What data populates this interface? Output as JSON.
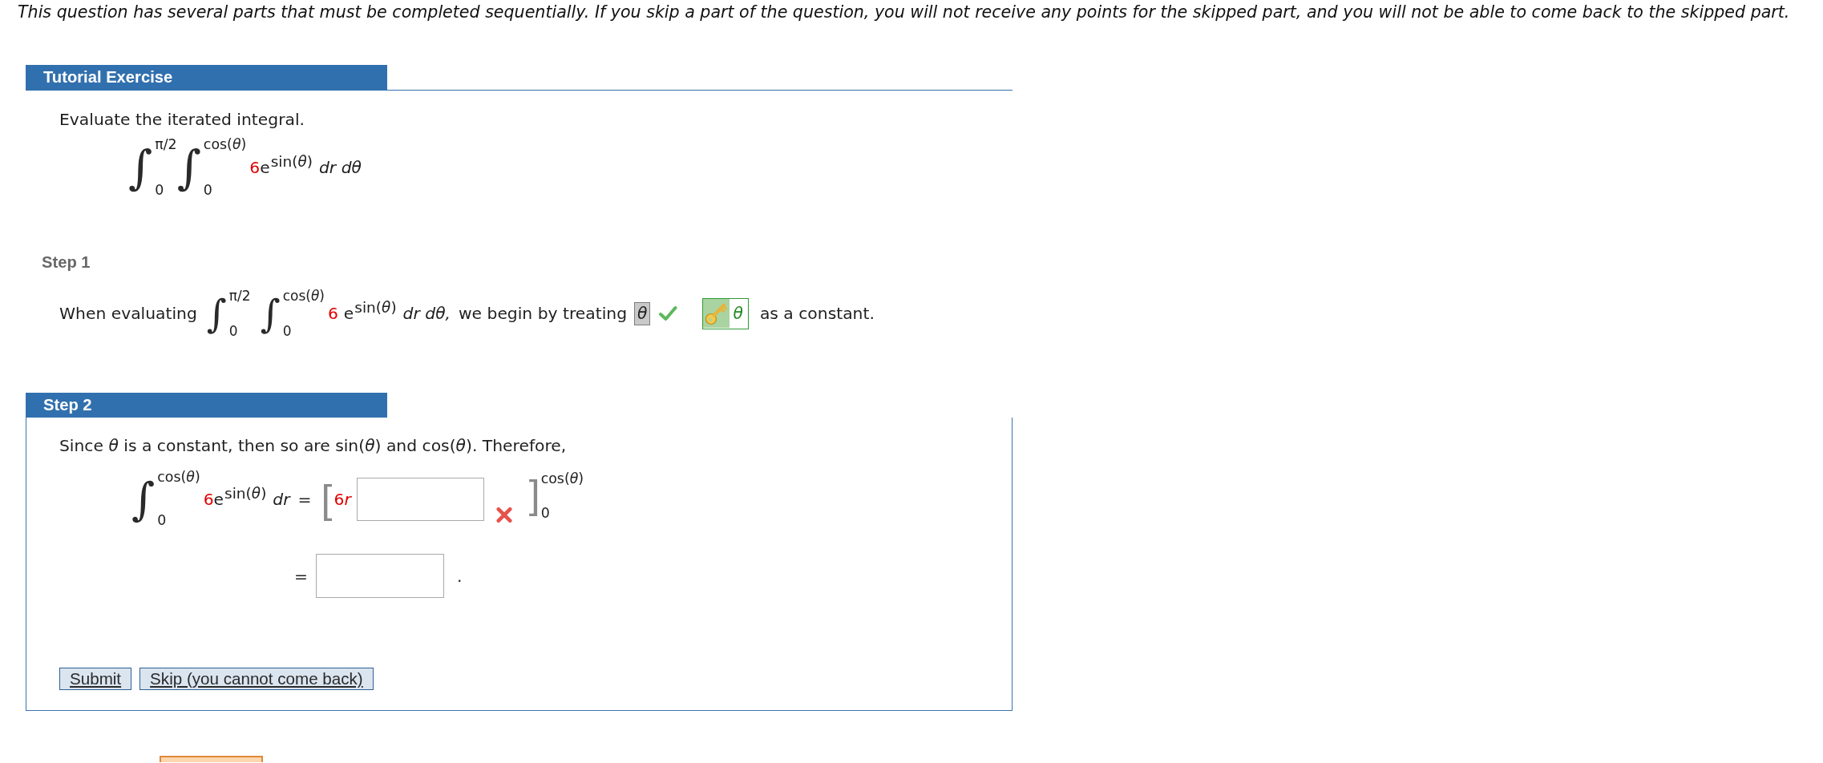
{
  "notice": "This question has several parts that must be completed sequentially. If you skip a part of the question, you will not receive any points for the skipped part, and you will not be able to come back to the skipped part.",
  "tutorial": {
    "title": "Tutorial Exercise",
    "prompt": "Evaluate the iterated integral.",
    "expression": {
      "integrals": [
        {
          "sign": "∫",
          "upper": "π/2",
          "lower": "0"
        },
        {
          "sign": "∫",
          "upper": "cos(*θ*)",
          "lower": "0"
        }
      ],
      "coefficient": "6",
      "base": "e",
      "exponent": "sin(*θ*)",
      "differentials": "dr dθ"
    }
  },
  "step_1": {
    "label": "Step 1",
    "lead": "When evaluating",
    "expression": {
      "integrals": [
        {
          "sign": "∫",
          "upper": "π/2",
          "lower": "0"
        },
        {
          "sign": "∫",
          "upper": "cos(*θ*)",
          "lower": "0"
        }
      ],
      "coefficient": "6",
      "base": "e",
      "exponent": "sin(*θ*)",
      "differentials": "dr dθ,"
    },
    "middle": "we begin by treating",
    "answer": {
      "value": "θ",
      "correct": true
    },
    "answer_key": {
      "value": "θ"
    },
    "tail": "as a constant."
  },
  "step_2": {
    "label": "Step 2",
    "prompt": "Since *θ* is a constant, then so are sin(*θ*) and cos(*θ*). Therefore,",
    "equation": {
      "integral": {
        "sign": "∫",
        "upper": "cos(*θ*)",
        "lower": "0"
      },
      "coefficient": "6",
      "base": "e",
      "exponent": "sin(*θ*)",
      "differential": "dr",
      "equals": "=",
      "open_bracket": "[",
      "term_coefficient": "6",
      "term_variable": "r",
      "answer": {
        "correct": false
      },
      "close_bracket": "]",
      "upper": "cos(*θ*)",
      "lower": "0"
    },
    "result": {
      "equals": "=",
      "end": "."
    },
    "buttons": [
      {
        "label": "Submit"
      },
      {
        "label": "Skip (you cannot come back)"
      }
    ]
  },
  "footer": {
    "button_visible": true
  }
}
